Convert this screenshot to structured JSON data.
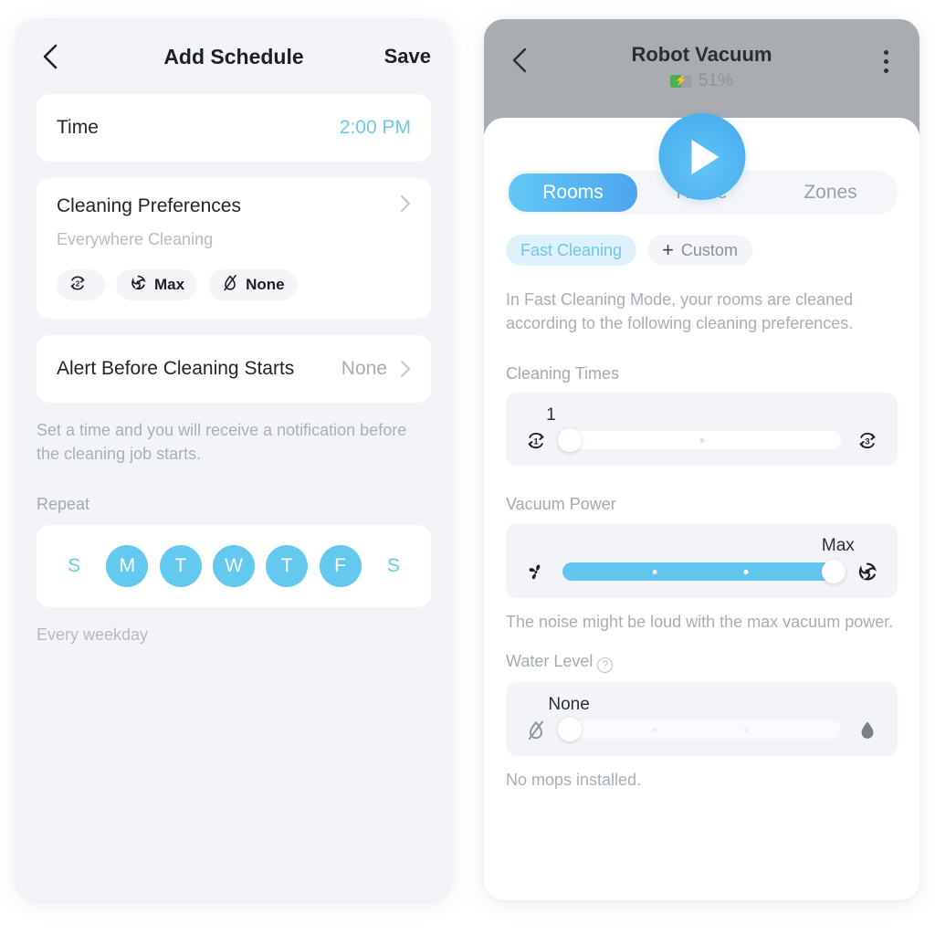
{
  "left_screen": {
    "header": {
      "back_icon": "chevron-left-icon",
      "title": "Add Schedule",
      "save_label": "Save"
    },
    "time_row": {
      "label": "Time",
      "value": "2:00 PM"
    },
    "cleaning_preferences": {
      "title": "Cleaning Preferences",
      "subtitle": "Everywhere Cleaning",
      "chips": [
        {
          "icon": "repeat-2-icon",
          "label": ""
        },
        {
          "icon": "vacuum-spiral-icon",
          "label": "Max"
        },
        {
          "icon": "water-drop-off-icon",
          "label": "None"
        }
      ]
    },
    "alert_row": {
      "label": "Alert Before Cleaning Starts",
      "value": "None"
    },
    "alert_help": "Set a time and you will receive a notification before the cleaning job starts.",
    "repeat": {
      "label": "Repeat",
      "days": [
        {
          "letter": "S",
          "selected": false
        },
        {
          "letter": "M",
          "selected": true
        },
        {
          "letter": "T",
          "selected": true
        },
        {
          "letter": "W",
          "selected": true
        },
        {
          "letter": "T",
          "selected": true
        },
        {
          "letter": "F",
          "selected": true
        },
        {
          "letter": "S",
          "selected": false
        }
      ],
      "summary": "Every weekday"
    }
  },
  "right_screen": {
    "header": {
      "back_icon": "chevron-left-icon",
      "title": "Robot Vacuum",
      "battery_text": "51%",
      "battery_percent": 51,
      "menu_icon": "kebab-menu-icon",
      "play_icon": "play-icon"
    },
    "tabs": [
      {
        "label": "Rooms",
        "active": true
      },
      {
        "label": "Home",
        "active": false
      },
      {
        "label": "Zones",
        "active": false
      }
    ],
    "mode_chips": [
      {
        "label": "Fast Cleaning",
        "selected": true
      },
      {
        "label": "Custom",
        "selected": false,
        "icon": "plus-icon"
      }
    ],
    "description": "In Fast Cleaning Mode, your rooms are cleaned according to the following cleaning preferences.",
    "cleaning_times": {
      "label": "Cleaning Times",
      "value": "1",
      "min_icon": "repeat-1-icon",
      "max_icon": "repeat-3-icon",
      "percent": 0,
      "ticks": [
        50
      ],
      "disabled": false
    },
    "vacuum_power": {
      "label": "Vacuum Power",
      "value": "Max",
      "min_icon": "fan-icon",
      "max_icon": "vacuum-spiral-icon",
      "percent": 100,
      "ticks": [
        33,
        66
      ],
      "note": "The noise might be loud with the max vacuum power.",
      "disabled": false
    },
    "water_level": {
      "label": "Water Level",
      "help_icon": "question-mark-icon",
      "value": "None",
      "min_icon": "water-drop-off-icon",
      "max_icon": "water-drop-icon",
      "percent": 0,
      "ticks": [
        33,
        66
      ],
      "note": "No mops installed.",
      "disabled": true
    }
  },
  "colors": {
    "accent_blue": "#62c5ee",
    "tab_gradient_start": "#62c8f5",
    "tab_gradient_end": "#4ea5ef",
    "page_bg": "#f2f4f8",
    "battery_green": "#4caf50"
  }
}
